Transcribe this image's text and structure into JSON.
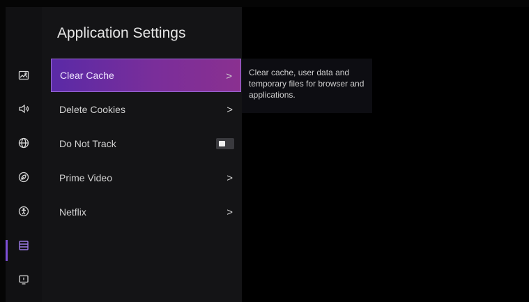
{
  "page": {
    "title": "Application Settings"
  },
  "rail": {
    "items": [
      {
        "icon": "picture-icon"
      },
      {
        "icon": "sound-icon"
      },
      {
        "icon": "network-icon"
      },
      {
        "icon": "eco-icon"
      },
      {
        "icon": "accessibility-icon"
      },
      {
        "icon": "apps-icon",
        "active": true
      },
      {
        "icon": "system-icon"
      }
    ]
  },
  "menu": {
    "items": [
      {
        "label": "Clear Cache",
        "chevron": ">"
      },
      {
        "label": "Delete Cookies",
        "chevron": ">"
      },
      {
        "label": "Do Not Track",
        "toggle": false
      },
      {
        "label": "Prime Video",
        "chevron": ">"
      },
      {
        "label": "Netflix",
        "chevron": ">"
      }
    ]
  },
  "description": "Clear cache, user data and temporary files for browser and applications.",
  "colors": {
    "accent": "#7d4fd6",
    "highlight_start": "#5a2aa6",
    "highlight_end": "#8a3090"
  }
}
